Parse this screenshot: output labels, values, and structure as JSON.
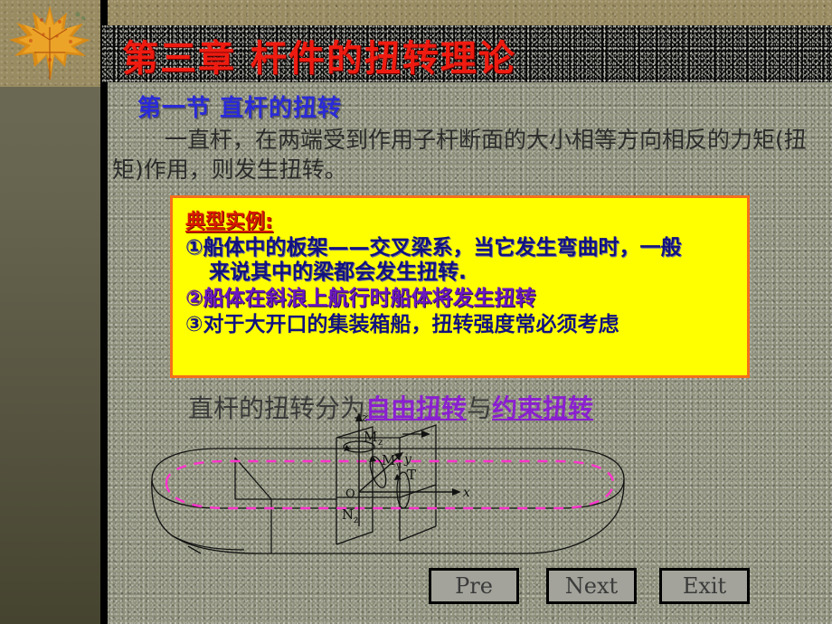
{
  "slide": {
    "title_main": "第三章  杆件的扭转理论",
    "title_sub": "第一节  直杆的扭转",
    "paragraph": "一直杆，在两端受到作用子杆断面的大小相等方向相反的力矩(扭矩)作用，则发生扭转。"
  },
  "example_box": {
    "heading": "典型实例:",
    "item1_line1": "①船体中的板架——交叉梁系，当它发生弯曲时，一般",
    "item1_line2": "来说其中的梁都会发生扭转.",
    "item2": "②船体在斜浪上航行时船体将发生扭转",
    "item3": "③对于大开口的集装箱船，扭转强度常必须考虑"
  },
  "link_line": {
    "prefix": "直杆的扭转分为",
    "link1": "自由扭转",
    "middle": "与",
    "link2": "约束扭转"
  },
  "diagram": {
    "axis_z": "z",
    "axis_x": "x",
    "axis_y": "y",
    "label_mz": "Mz",
    "label_my": "My",
    "label_t": "T",
    "label_o": "O",
    "label_nz": "Nz"
  },
  "buttons": {
    "pre": "Pre",
    "next": "Next",
    "exit": "Exit"
  },
  "colors": {
    "title_red": "#ef1b10",
    "subtitle_blue": "#2a2ad8",
    "box_fill": "#ffff00",
    "box_border": "#f36f1a",
    "link_purple": "#8a1fd0",
    "dashed_magenta": "#ff33cc",
    "body_bg": "#8d8f7a"
  }
}
